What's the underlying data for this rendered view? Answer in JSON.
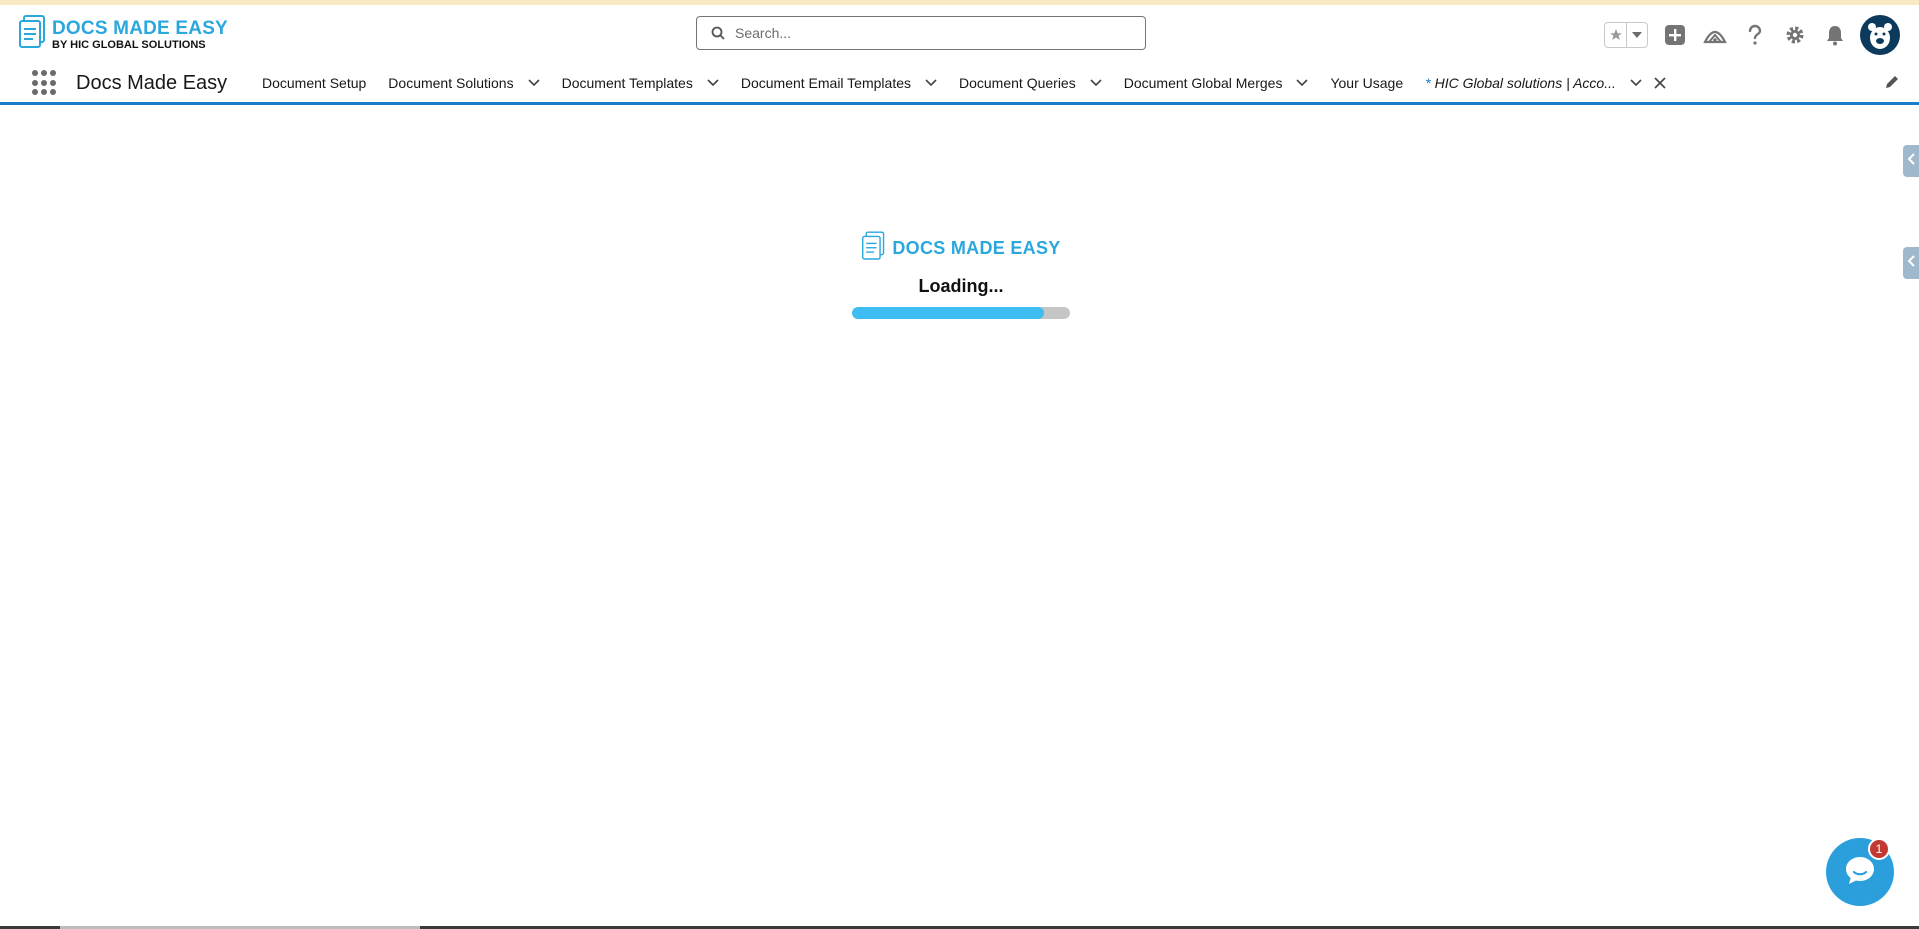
{
  "header": {
    "logo": {
      "title": "DOCS MADE EASY",
      "subtitle": "BY HIC GLOBAL SOLUTIONS"
    },
    "search": {
      "placeholder": "Search..."
    },
    "icons": [
      "favorites-star-icon",
      "favorites-caret-icon",
      "global-actions-plus-icon",
      "trailhead-icon",
      "help-icon",
      "setup-gear-icon",
      "notifications-bell-icon",
      "user-avatar"
    ]
  },
  "nav": {
    "app_name": "Docs Made Easy",
    "tabs": [
      {
        "label": "Document Setup",
        "has_menu": false
      },
      {
        "label": "Document Solutions",
        "has_menu": true
      },
      {
        "label": "Document Templates",
        "has_menu": true
      },
      {
        "label": "Document Email Templates",
        "has_menu": true
      },
      {
        "label": "Document Queries",
        "has_menu": true
      },
      {
        "label": "Document Global Merges",
        "has_menu": true
      },
      {
        "label": "Your Usage",
        "has_menu": false
      }
    ],
    "active_tab": {
      "modified_marker": "*",
      "label": "HIC Global solutions | Acco..."
    }
  },
  "loader": {
    "brand": "DOCS MADE EASY",
    "status": "Loading...",
    "progress_percent": 88
  },
  "chat": {
    "badge_count": "1"
  },
  "colors": {
    "brand": "#2aa8de",
    "nav_underline": "#1b7bc7",
    "progress_fill": "#3dbdf1",
    "badge": "#c23934"
  }
}
